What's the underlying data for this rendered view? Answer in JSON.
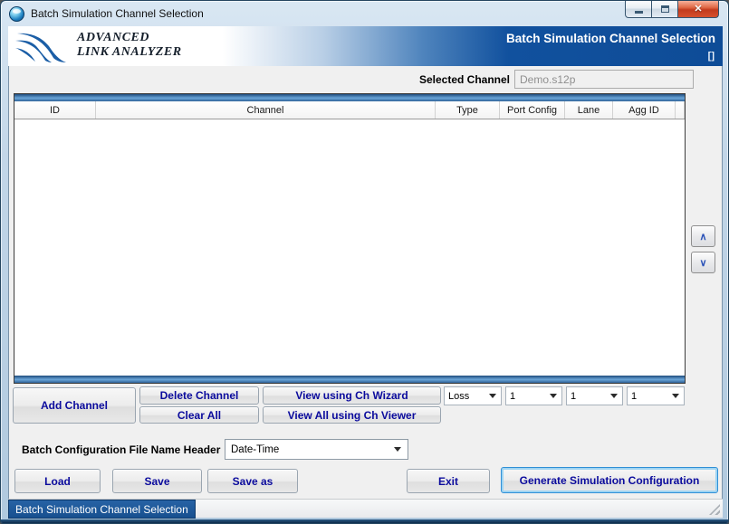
{
  "window": {
    "title": "Batch Simulation Channel Selection"
  },
  "icons": {
    "app_icon": "globe-sphere",
    "minimize": "minimize-bar",
    "maximize": "restore-box",
    "close_glyph": "✕",
    "scroll_up_glyph": "∧",
    "scroll_down_glyph": "∨"
  },
  "header": {
    "logo_line1": "ADVANCED",
    "logo_line2": "LINK ANALYZER",
    "title": "Batch Simulation Channel Selection",
    "subtitle": "[]"
  },
  "selected_channel": {
    "label": "Selected Channel",
    "value": "Demo.s12p"
  },
  "table": {
    "columns": [
      "ID",
      "Channel",
      "Type",
      "Port Config",
      "Lane",
      "Agg ID"
    ],
    "rows": []
  },
  "actions": {
    "add_channel": "Add Channel",
    "delete_channel": "Delete Channel",
    "clear_all": "Clear All",
    "view_wizard": "View using Ch Wizard",
    "view_viewer": "View All using Ch Viewer",
    "combos": [
      {
        "value": "Loss"
      },
      {
        "value": "1"
      },
      {
        "value": "1"
      },
      {
        "value": "1"
      }
    ]
  },
  "config": {
    "label": "Batch Configuration File Name Header",
    "value": "Date-Time"
  },
  "footer": {
    "load": "Load",
    "save": "Save",
    "save_as": "Save as",
    "exit": "Exit",
    "generate": "Generate Simulation Configuration"
  },
  "status": {
    "text": "Batch Simulation Channel Selection"
  },
  "colors": {
    "header_blue": "#0F509E",
    "bar_blue": "#4F87BD",
    "button_text_navy": "#0B0B9D",
    "status_badge_blue": "#17508F",
    "close_red": "#C23A1D",
    "focus_ring_blue": "#2F8FD6"
  }
}
